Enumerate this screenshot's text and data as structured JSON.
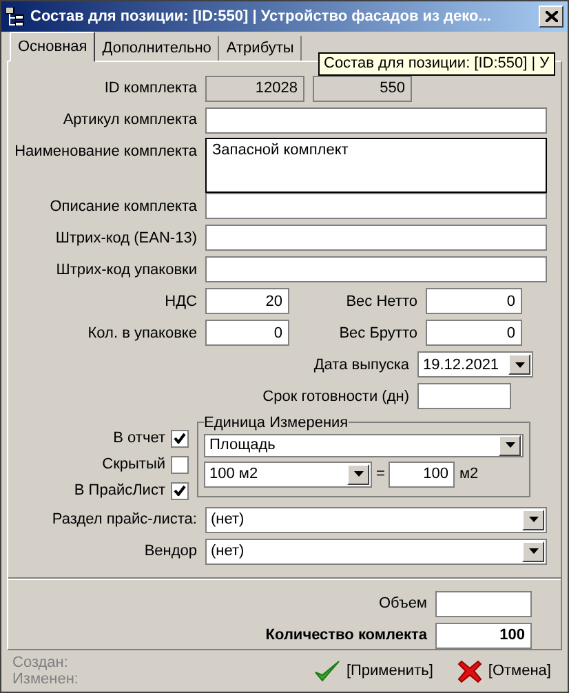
{
  "window": {
    "title": "Состав для позиции: [ID:550]  | Устройство фасадов из деко..."
  },
  "tabs": [
    {
      "label": "Основная",
      "selected": true
    },
    {
      "label": "Дополнительно",
      "selected": false
    },
    {
      "label": "Атрибуты",
      "selected": false
    }
  ],
  "tooltip": "Состав для позиции: [ID:550] | У",
  "id_row": {
    "label": "ID комплекта",
    "values": [
      "12028",
      "550"
    ]
  },
  "text_fields": [
    {
      "label": "Артикул комплекта",
      "kind": "line"
    },
    {
      "label": "Наименование комплекта",
      "value": "Запасной комплект",
      "kind": "multiline"
    },
    {
      "label": "Описание комплекта",
      "kind": "line"
    },
    {
      "label": "Штрих-код (EAN-13)",
      "kind": "line"
    },
    {
      "label": "Штрих-код упаковки",
      "kind": "line"
    }
  ],
  "number_rows": [
    {
      "left": {
        "label": "НДС",
        "value": "20"
      },
      "right": {
        "label": "Вес Нетто",
        "value": "0"
      }
    },
    {
      "left": {
        "label": "Кол. в упаковке",
        "value": "0"
      },
      "right": {
        "label": "Вес Брутто",
        "value": "0"
      }
    }
  ],
  "release_date": {
    "label": "Дата выпуска",
    "value": "19.12.2021"
  },
  "ready_days": {
    "label": "Срок готовности (дн)"
  },
  "checkboxes": [
    {
      "label": "В отчет",
      "checked": true
    },
    {
      "label": "Скрытый",
      "checked": false
    },
    {
      "label": "В ПрайсЛист",
      "checked": true
    }
  ],
  "unit_group": {
    "title": "Единица Измерения",
    "type": "Площадь",
    "unit": "100 м2",
    "equals": "=",
    "amount": "100",
    "suffix": "м2"
  },
  "selects": [
    {
      "label": "Раздел прайс-листа:",
      "value": "(нет)"
    },
    {
      "label": "Вендор",
      "value": "(нет)"
    }
  ],
  "volume": {
    "label": "Объем"
  },
  "quantity": {
    "label": "Количество комлекта",
    "value": "100"
  },
  "footer": {
    "meta": [
      "Создан:",
      "Изменен:"
    ],
    "buttons": [
      {
        "label": "[Применить]",
        "kind": "apply"
      },
      {
        "label": "[Отмена]",
        "kind": "cancel"
      }
    ]
  }
}
